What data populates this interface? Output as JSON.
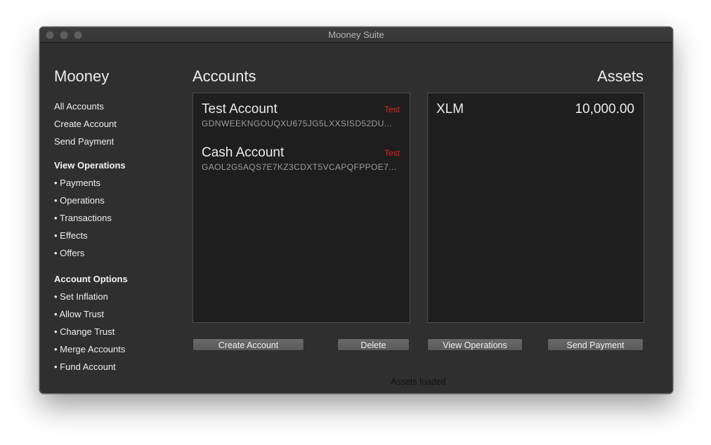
{
  "window": {
    "title": "Mooney Suite"
  },
  "sidebar": {
    "title": "Mooney",
    "items": [
      "All Accounts",
      "Create Account",
      "Send Payment"
    ],
    "view_operations": {
      "heading": "View Operations",
      "items": [
        "• Payments",
        "• Operations",
        "• Transactions",
        "• Effects",
        "• Offers"
      ]
    },
    "account_options": {
      "heading": "Account Options",
      "items": [
        "• Set Inflation",
        "• Allow Trust",
        "• Change Trust",
        "• Merge Accounts",
        "• Fund Account"
      ]
    }
  },
  "accounts": {
    "title": "Accounts",
    "list": [
      {
        "name": "Test Account",
        "tag": "Test",
        "key": "GDNWEEKNGOUQXU675JG5LXXSISD52DU..."
      },
      {
        "name": "Cash Account",
        "tag": "Test",
        "key": "GAOL2G5AQS7E7KZ3CDXT5VCAPQFPPOE7..."
      }
    ],
    "create_button": "Create Account",
    "delete_button": "Delete"
  },
  "assets": {
    "title": "Assets",
    "list": [
      {
        "code": "XLM",
        "balance": "10,000.00"
      }
    ],
    "view_operations_button": "View Operations",
    "send_payment_button": "Send Payment"
  },
  "status": "Assets loaded",
  "colors": {
    "window_bg": "#2f2f2f",
    "panel_bg": "#1e1e1e",
    "test_tag": "#e0221b",
    "button_bg": "#626262"
  }
}
